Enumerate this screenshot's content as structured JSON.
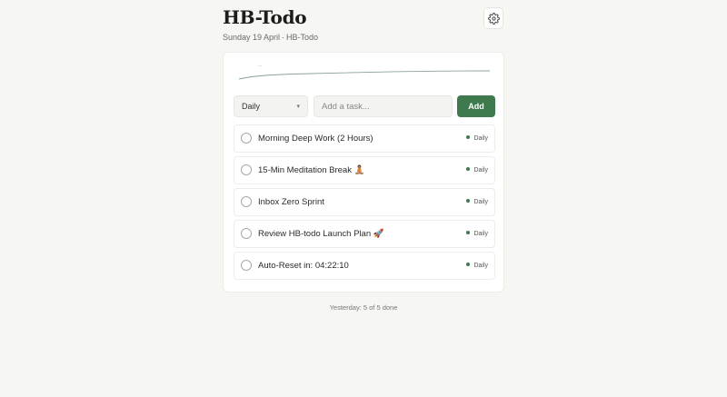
{
  "app": {
    "title": "HB-Todo",
    "date": "Sunday 19 April",
    "separator": "·",
    "subtitle_app": "HB-Todo"
  },
  "settings": {
    "icon": "gear-icon"
  },
  "sparkline": {
    "label": "..."
  },
  "controls": {
    "frequency_selected": "Daily",
    "input_placeholder": "Add a task...",
    "input_value": "",
    "add_label": "Add"
  },
  "tasks": [
    {
      "label": "Morning Deep Work (2 Hours)",
      "tag": "Daily"
    },
    {
      "label": "15-Min Meditation Break 🧘🏽",
      "tag": "Daily"
    },
    {
      "label": "Inbox Zero Sprint",
      "tag": "Daily"
    },
    {
      "label": "Review HB-todo Launch Plan 🚀",
      "tag": "Daily"
    },
    {
      "label": "Auto-Reset in: 04:22:10",
      "tag": "Daily"
    }
  ],
  "footer": {
    "text": "Yesterday: 5 of 5 done"
  },
  "colors": {
    "accent": "#3f7a4f",
    "background": "#f6f6f3",
    "card": "#ffffff"
  }
}
